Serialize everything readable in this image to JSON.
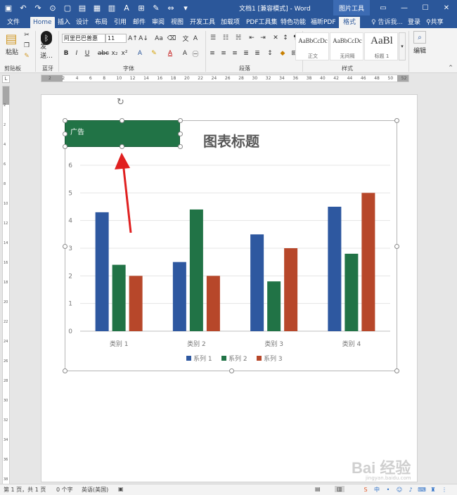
{
  "titlebar": {
    "doc_title": "文档1 [兼容模式] - Word",
    "tool_title": "图片工具",
    "qat_icons": [
      "save-icon",
      "undo-icon",
      "redo-icon",
      "print-preview-icon",
      "new-doc-icon",
      "clipboard-icon",
      "layout-icon",
      "page-icon",
      "font-color-icon",
      "table-icon",
      "draw-icon",
      "spacing-icon",
      "dropdown-icon"
    ],
    "window_controls": [
      "restore-ribbon-icon",
      "minimize-icon",
      "maximize-icon",
      "close-icon"
    ]
  },
  "tabs": {
    "file": "文件",
    "home": "Home",
    "insert": "插入",
    "design": "设计",
    "layout": "布局",
    "references": "引用",
    "mailings": "邮件",
    "review": "审阅",
    "view": "视图",
    "developer": "开发工具",
    "addins": "加载项",
    "pdf_toolset": "PDF工具集",
    "special": "特色功能",
    "foxit": "福昕PDF",
    "format": "格式",
    "tell_me": "告诉我...",
    "login": "登录",
    "share": "共享"
  },
  "ribbon": {
    "paste_label": "粘贴",
    "send_label": "发送...",
    "font_name": "阿里巴巴普惠",
    "font_size": "11",
    "styles": [
      {
        "sample": "AaBbCcDc",
        "name": "正文"
      },
      {
        "sample": "AaBbCcDc",
        "name": "无间隔"
      },
      {
        "sample": "AaBl",
        "name": "标题 1"
      }
    ],
    "edit_label": "编辑",
    "groups": {
      "clipboard": "剪贴板",
      "bluetooth": "蓝牙",
      "font": "字体",
      "paragraph": "段落",
      "styles": "样式"
    }
  },
  "ruler": {
    "h_numbers": [
      "2",
      "2",
      "4",
      "6",
      "8",
      "10",
      "12",
      "14",
      "16",
      "18",
      "20",
      "22",
      "24",
      "26",
      "28",
      "30",
      "32",
      "34",
      "36",
      "38",
      "40",
      "42",
      "44",
      "46",
      "48",
      "50",
      "52"
    ],
    "v_numbers": [
      "2",
      "2",
      "4",
      "6",
      "8",
      "10",
      "12",
      "14",
      "16",
      "18",
      "20",
      "22",
      "24",
      "26",
      "28",
      "30",
      "32",
      "34",
      "36",
      "38",
      "40"
    ]
  },
  "shape": {
    "text": "广告"
  },
  "chart_data": {
    "type": "bar",
    "title": "图表标题",
    "categories": [
      "类别 1",
      "类别 2",
      "类别 3",
      "类别 4"
    ],
    "series": [
      {
        "name": "系列 1",
        "values": [
          4.3,
          2.5,
          3.5,
          4.5
        ],
        "color": "#2e58a0"
      },
      {
        "name": "系列 2",
        "values": [
          2.4,
          4.4,
          1.8,
          2.8
        ],
        "color": "#217346"
      },
      {
        "name": "系列 3",
        "values": [
          2.0,
          2.0,
          3.0,
          5.0
        ],
        "color": "#b7472a"
      }
    ],
    "ylim": [
      0,
      6
    ],
    "yticks": [
      "0",
      "1",
      "2",
      "3",
      "4",
      "5",
      "6"
    ],
    "grid": true,
    "legend": "bottom"
  },
  "status": {
    "page": "第 1 页，共 1 页",
    "words": "0 个字",
    "lang": "英语(美国)"
  },
  "watermark": {
    "text": "Bai 经验",
    "sub": "jingyan.baidu.com"
  }
}
